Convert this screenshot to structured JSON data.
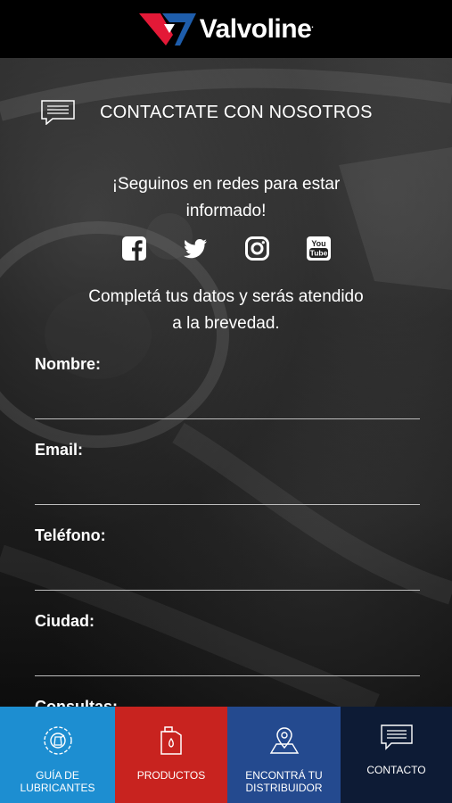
{
  "header": {
    "brand": "Valvoline",
    "brand_mark": ".",
    "colors": {
      "red": "#e31937",
      "blue": "#1e5dab",
      "background": "#000000"
    }
  },
  "contact": {
    "title": "CONTACTATE CON NOSOTROS",
    "icon": "chat-bubble-icon"
  },
  "social": {
    "text_line1": "¡Seguinos en redes para estar",
    "text_line2": "informado!",
    "icons": [
      "facebook-icon",
      "twitter-icon",
      "instagram-icon",
      "youtube-icon"
    ],
    "youtube_label_1": "You",
    "youtube_label_2": "Tube"
  },
  "intro": {
    "line1": "Completá tus datos y serás atendido",
    "line2": "a la brevedad."
  },
  "form": {
    "nombre_label": "Nombre:",
    "email_label": "Email:",
    "telefono_label": "Teléfono:",
    "ciudad_label": "Ciudad:",
    "consultas_label": "Consultas:"
  },
  "nav": {
    "items": [
      {
        "label": "GUÍA DE LUBRICANTES",
        "icon": "lubricant-guide-icon",
        "color": "#1d8ed1"
      },
      {
        "label": "PRODUCTOS",
        "icon": "oil-can-icon",
        "color": "#c8231f"
      },
      {
        "label": "ENCONTRÁ TU DISTRIBUIDOR",
        "icon": "map-pin-icon",
        "color": "#244a8f"
      },
      {
        "label": "CONTACTO",
        "icon": "chat-bubble-icon",
        "color": "#0d1b35"
      }
    ]
  }
}
